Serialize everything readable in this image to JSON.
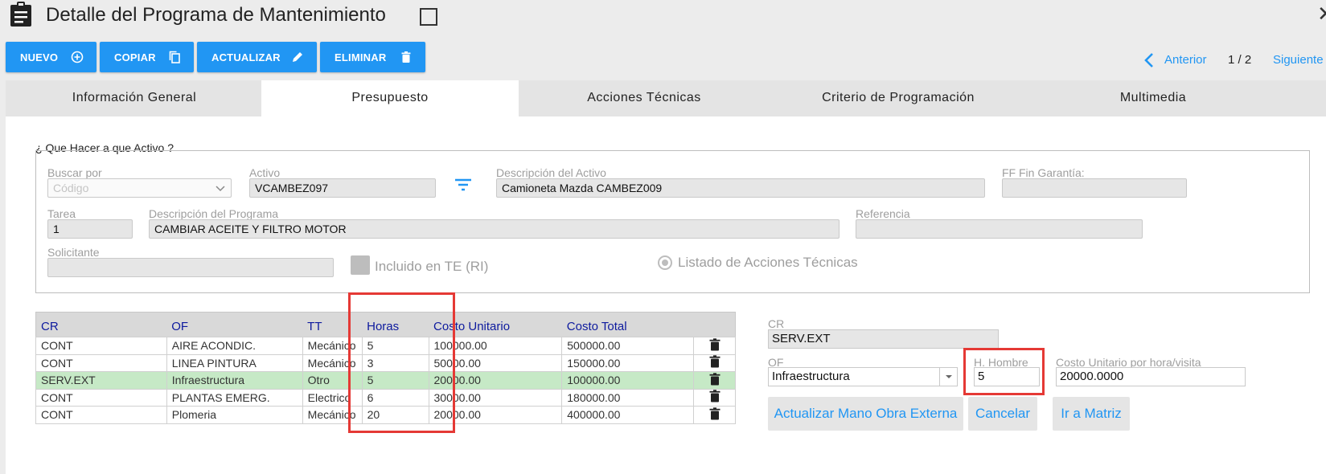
{
  "header": {
    "title": "Detalle del Programa de Mantenimiento",
    "doc_icon": "clipboard-icon",
    "pin_icon": "checkbox-outline-icon"
  },
  "toolbar": {
    "new_label": "NUEVO",
    "copy_label": "COPIAR",
    "update_label": "ACTUALIZAR",
    "delete_label": "ELIMINAR",
    "accent": "#2196f3"
  },
  "pager": {
    "prev_label": "Anterior",
    "count": "1 / 2",
    "next_label": "Siguiente"
  },
  "tabs": [
    {
      "label": "Información General",
      "active": false
    },
    {
      "label": "Presupuesto",
      "active": true
    },
    {
      "label": "Acciones Técnicas",
      "active": false
    },
    {
      "label": "Criterio de Programación",
      "active": false
    },
    {
      "label": "Multimedia",
      "active": false
    }
  ],
  "form": {
    "section_title": "¿ Que Hacer a que Activo ?",
    "search_by": {
      "label": "Buscar por",
      "placeholder": "Código"
    },
    "asset": {
      "label": "Activo",
      "value": "VCAMBEZ097"
    },
    "asset_desc": {
      "label": "Descripción del Activo",
      "value": "Camioneta Mazda CAMBEZ009"
    },
    "warranty_end": {
      "label": "FF Fin Garantía:",
      "value": ""
    },
    "task": {
      "label": "Tarea",
      "value": "1"
    },
    "program_desc": {
      "label": "Descripción del Programa",
      "value": "CAMBIAR ACEITE Y FILTRO MOTOR"
    },
    "reference": {
      "label": "Referencia",
      "value": ""
    },
    "requester": {
      "label": "Solicitante",
      "value": ""
    },
    "included_label": "Incluido en TE (RI)",
    "actions_list_label": "Listado de Acciones Técnicas"
  },
  "table": {
    "headers": [
      "CR",
      "OF",
      "TT",
      "Horas",
      "Costo Unitario",
      "Costo Total"
    ],
    "rows": [
      {
        "cr": "CONT",
        "of": "AIRE ACONDIC.",
        "tt": "Mecánico",
        "horas": "5",
        "unit": "100000.00",
        "total": "500000.00",
        "selected": false
      },
      {
        "cr": "CONT",
        "of": "LINEA PINTURA",
        "tt": "Mecánico",
        "horas": "3",
        "unit": "50000.00",
        "total": "150000.00",
        "selected": false
      },
      {
        "cr": "SERV.EXT",
        "of": "Infraestructura",
        "tt": "Otro",
        "horas": "5",
        "unit": "20000.00",
        "total": "100000.00",
        "selected": true
      },
      {
        "cr": "CONT",
        "of": "PLANTAS EMERG.",
        "tt": "Electrico",
        "horas": "6",
        "unit": "30000.00",
        "total": "180000.00",
        "selected": false
      },
      {
        "cr": "CONT",
        "of": "Plomeria",
        "tt": "Mecánico",
        "horas": "20",
        "unit": "20000.00",
        "total": "400000.00",
        "selected": false
      }
    ]
  },
  "detail": {
    "cr_label": "CR",
    "cr_value": "SERV.EXT",
    "of_label": "OF",
    "of_value": "Infraestructura",
    "hh_label": "H. Hombre",
    "hh_value": "5",
    "unit_cost_label": "Costo Unitario por hora/visita",
    "unit_cost_value": "20000.0000",
    "update_btn": "Actualizar Mano Obra Externa",
    "cancel_btn": "Cancelar",
    "matrix_btn": "Ir a Matriz"
  },
  "highlight_color": "#e53935"
}
